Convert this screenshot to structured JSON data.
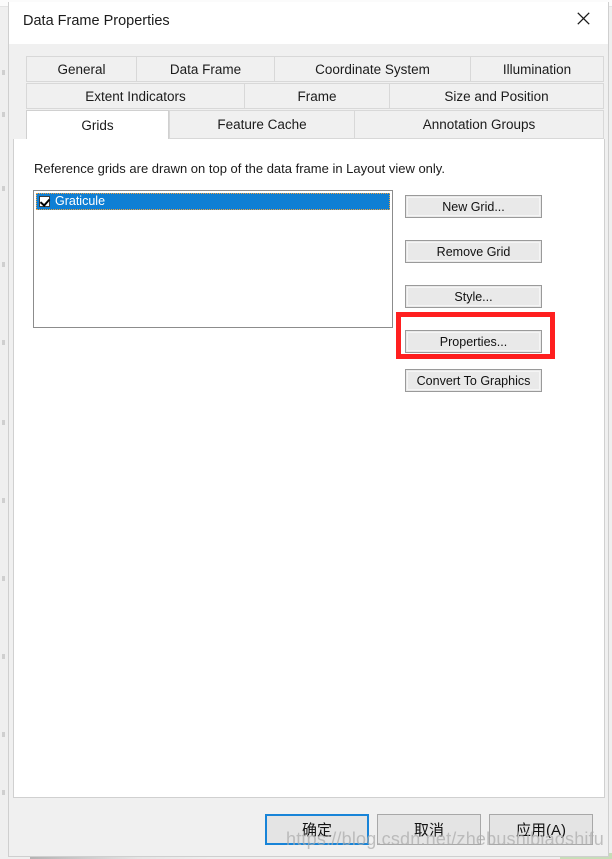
{
  "window": {
    "title": "Data Frame Properties",
    "close_icon": "close-x-icon"
  },
  "tabs": {
    "row1": [
      {
        "label": "General",
        "selected": false
      },
      {
        "label": "Data Frame",
        "selected": false
      },
      {
        "label": "Coordinate System",
        "selected": false
      },
      {
        "label": "Illumination",
        "selected": false
      }
    ],
    "row2": [
      {
        "label": "Extent Indicators",
        "selected": false
      },
      {
        "label": "Frame",
        "selected": false
      },
      {
        "label": "Size and Position",
        "selected": false
      }
    ],
    "row3": [
      {
        "label": "Grids",
        "selected": true
      },
      {
        "label": "Feature Cache",
        "selected": false
      },
      {
        "label": "Annotation Groups",
        "selected": false
      }
    ]
  },
  "grids_tab": {
    "description": "Reference grids are drawn on top of the data frame in Layout view only.",
    "list": [
      {
        "label": "Graticule",
        "checked": true,
        "selected": true
      }
    ],
    "buttons": [
      {
        "label": "New Grid..."
      },
      {
        "label": "Remove Grid"
      },
      {
        "label": "Style..."
      },
      {
        "label": "Properties..."
      },
      {
        "label": "Convert To Graphics"
      }
    ],
    "highlight": {
      "target": "Properties...",
      "color": "#ff1f1f"
    }
  },
  "footer": {
    "ok_label": "确定",
    "cancel_label": "取消",
    "apply_label": "应用(A)"
  },
  "watermark": {
    "text": "https://blog.csdn.net/zhebushibiaoshifu"
  },
  "colors": {
    "selection_blue": "#0f7fd4",
    "focus_blue": "#1884d8",
    "annotation_red": "#ff1f1f",
    "dialog_bg": "#f0f0f0",
    "panel_bg": "#ffffff"
  }
}
